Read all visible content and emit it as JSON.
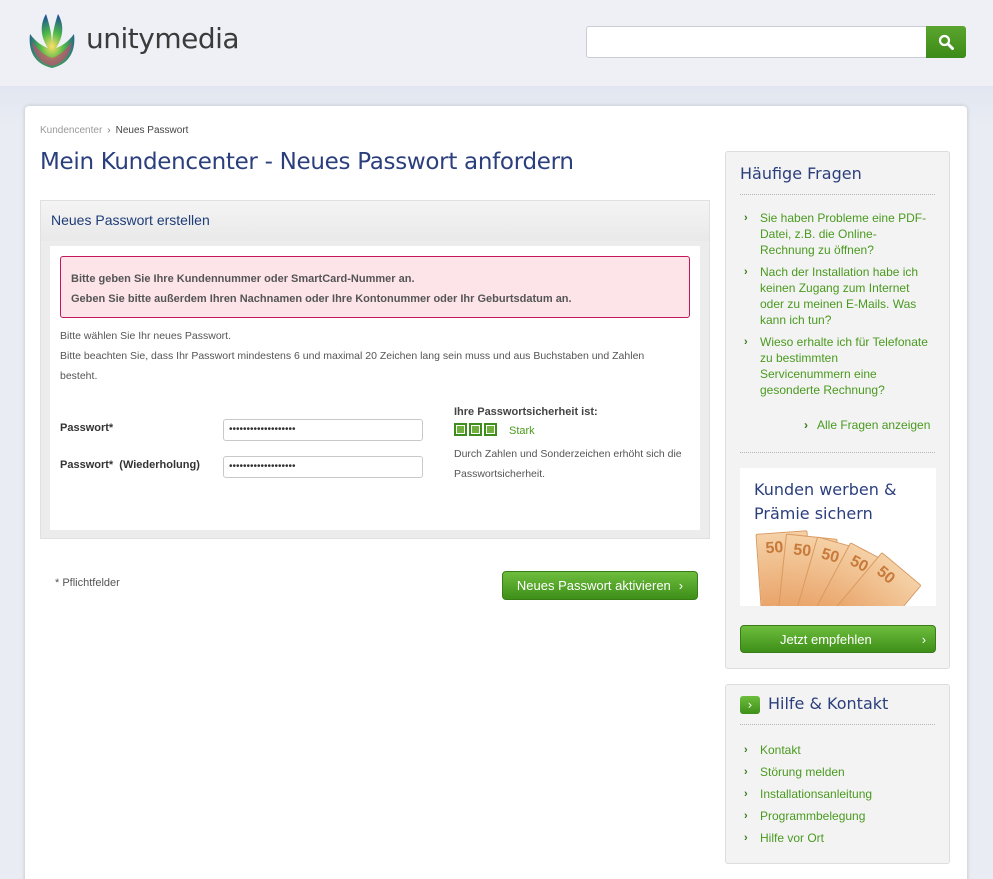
{
  "header": {
    "logo_text": "unitymedia",
    "search": {
      "placeholder": "",
      "value": ""
    }
  },
  "breadcrumb": {
    "root": "Kundencenter",
    "current": "Neues Passwort"
  },
  "page_title": "Mein Kundencenter - Neues Passwort anfordern",
  "form": {
    "heading": "Neues Passwort erstellen",
    "errors": [
      "Bitte geben Sie Ihre Kundennummer oder SmartCard-Nummer an.",
      "Geben Sie bitte außerdem Ihren Nachnamen oder Ihre Kontonummer oder Ihr Geburtsdatum an."
    ],
    "info": [
      "Bitte wählen Sie Ihr neues Passwort.",
      "Bitte beachten Sie, dass Ihr Passwort mindestens 6 und maximal 20 Zeichen lang sein muss und aus Buchstaben und Zahlen besteht."
    ],
    "password_label": "Passwort*",
    "password_value": "•••••••••••••••••••",
    "password_repeat_label": "Passwort*  (Wiederholung)",
    "password_repeat_value": "•••••••••••••••••••",
    "strength": {
      "title": "Ihre Passwortsicherheit ist:",
      "level": 3,
      "max": 3,
      "word": "Stark",
      "hint": "Durch Zahlen und Sonderzeichen erhöht sich die Passwortsicherheit."
    },
    "required_note": "* Pflichtfelder",
    "submit_label": "Neues Passwort aktivieren"
  },
  "faq": {
    "title": "Häufige Fragen",
    "items": [
      "Sie haben Probleme eine PDF-Datei, z.B. die Online-Rechnung zu öffnen?",
      "Nach der Installation habe ich keinen Zugang zum Internet oder zu meinen E-Mails. Was kann ich tun?",
      "Wieso erhalte ich für Telefonate zu bestimmten Servicenummern eine gesonderte Rechnung?"
    ],
    "all_link": "Alle Fragen anzeigen",
    "promo_title": "Kunden werben & Prämie sichern",
    "promo_button": "Jetzt empfehlen"
  },
  "help": {
    "title": "Hilfe & Kontakt",
    "items": [
      "Kontakt",
      "Störung melden",
      "Installationsanleitung",
      "Programmbelegung",
      "Hilfe vor Ort"
    ]
  },
  "colors": {
    "brand_blue": "#2b3f7d",
    "brand_green": "#4a9a1f",
    "error_border": "#c2185b"
  }
}
